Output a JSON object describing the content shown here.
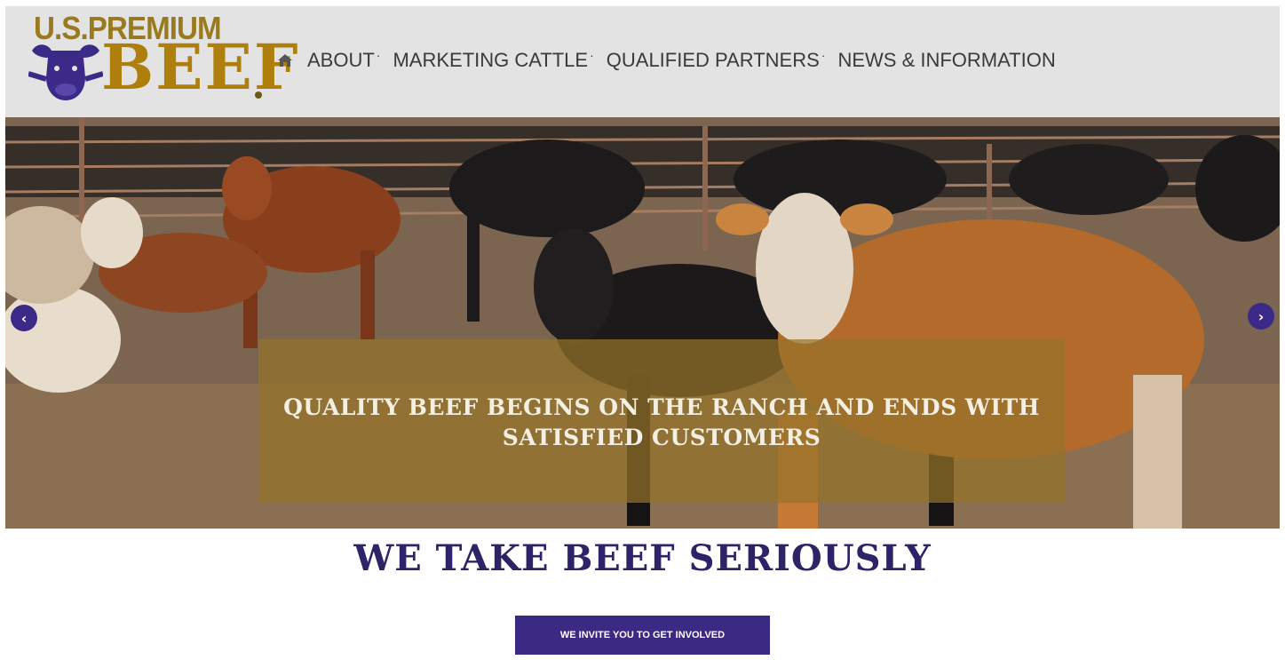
{
  "brand": {
    "logo_top": "U.S.PREMIUM",
    "logo_bottom": "BEEF"
  },
  "nav": {
    "home_icon": "home-icon",
    "items": [
      {
        "label": "ABOUT"
      },
      {
        "label": "MARKETING CATTLE"
      },
      {
        "label": "QUALIFIED PARTNERS"
      },
      {
        "label": "NEWS & INFORMATION"
      }
    ]
  },
  "hero": {
    "caption": "QUALITY BEEF BEGINS ON THE RANCH AND ENDS WITH SATISFIED CUSTOMERS",
    "prev_icon": "chevron-left-icon",
    "next_icon": "chevron-right-icon"
  },
  "tagline": "WE TAKE BEEF SERIOUSLY",
  "cta": {
    "label": "WE INVITE YOU TO GET INVOLVED"
  },
  "colors": {
    "header_bg": "#e3e3e3",
    "brand_gold": "#ae7f0d",
    "brand_purple": "#3a2a83",
    "nav_text": "#3a3a3a"
  }
}
